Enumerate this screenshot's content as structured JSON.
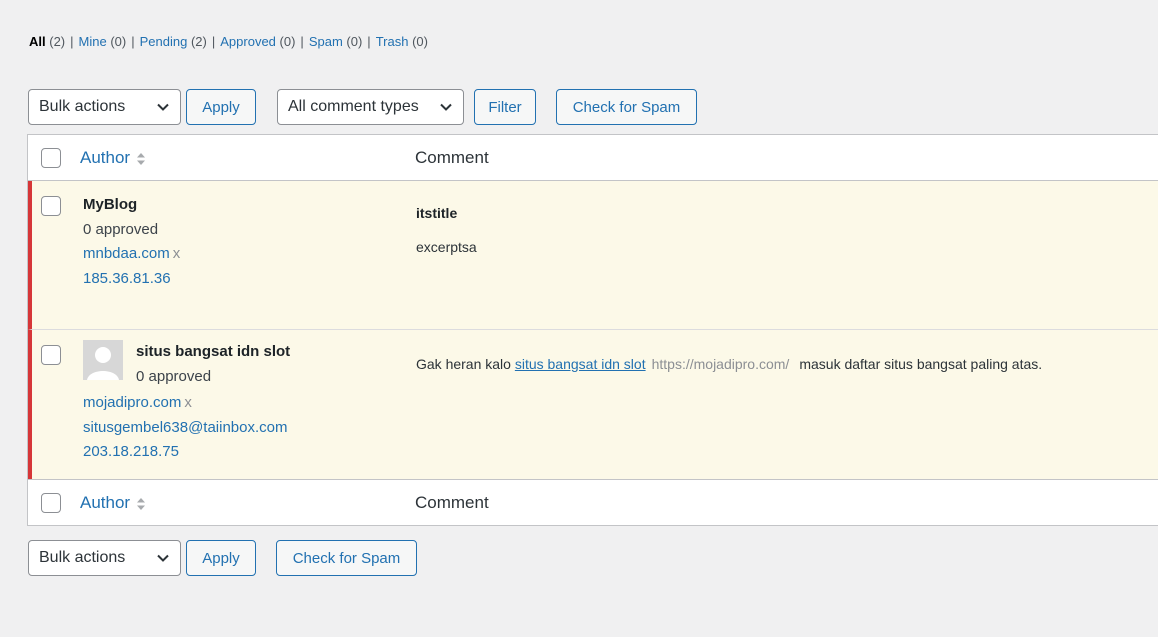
{
  "filters": [
    {
      "label": "All",
      "count": "(2)"
    },
    {
      "label": "Mine",
      "count": "(0)"
    },
    {
      "label": "Pending",
      "count": "(2)"
    },
    {
      "label": "Approved",
      "count": "(0)"
    },
    {
      "label": "Spam",
      "count": "(0)"
    },
    {
      "label": "Trash",
      "count": "(0)"
    }
  ],
  "separator": "|",
  "toolbar_top": {
    "bulk_actions": "Bulk actions",
    "apply": "Apply",
    "comment_types": "All comment types",
    "filter": "Filter",
    "check_spam": "Check for Spam"
  },
  "table": {
    "col_author": "Author",
    "col_comment": "Comment",
    "rows": [
      {
        "author": "MyBlog",
        "approved": "0 approved",
        "site": "mnbdaa.com",
        "remove": "x",
        "ip": "185.36.81.36",
        "title": "itstitle",
        "excerpt": "excerptsa"
      },
      {
        "author": "situs bangsat idn slot",
        "approved": "0 approved",
        "site": "mojadipro.com",
        "remove": "x",
        "email": "situsgembel638@taiinbox.com",
        "ip": "203.18.218.75",
        "text_before": "Gak heran kalo",
        "link_text": "situs bangsat idn slot",
        "url_text": "https://mojadipro.com/",
        "text_after": "masuk daftar situs bangsat paling atas."
      }
    ]
  },
  "toolbar_bottom": {
    "bulk_actions": "Bulk actions",
    "apply": "Apply",
    "check_spam": "Check for Spam"
  },
  "colors": {
    "link": "#2271b1",
    "pending_row_bg": "#fcf9e8",
    "pending_border": "#d63638",
    "page_bg": "#f0f0f1"
  },
  "icons": {
    "sort": "sort-icon",
    "chevron": "chevron-down-icon",
    "avatar": "avatar-placeholder-icon"
  }
}
